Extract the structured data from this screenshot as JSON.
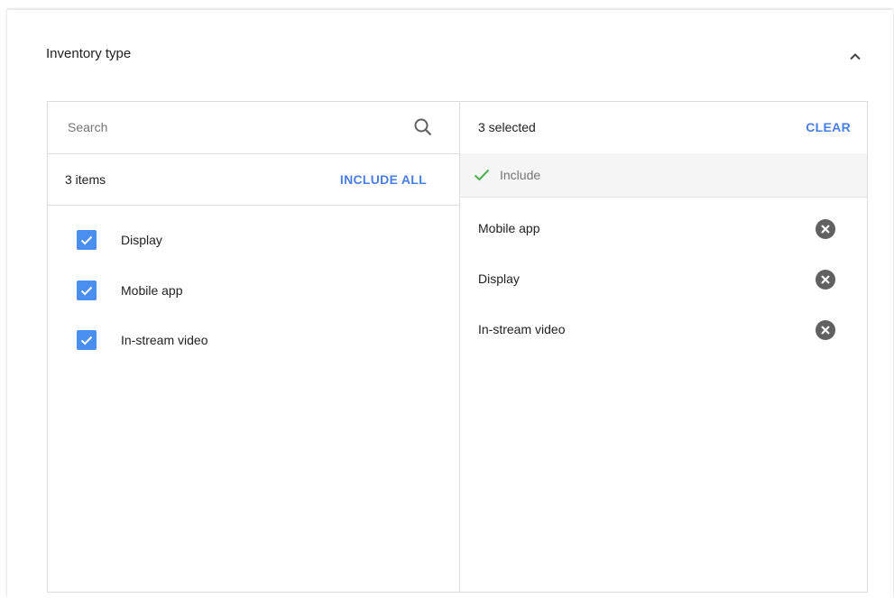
{
  "section": {
    "title": "Inventory type"
  },
  "search": {
    "placeholder": "Search",
    "value": ""
  },
  "available": {
    "count_label": "3 items",
    "include_all_label": "INCLUDE ALL",
    "options": [
      {
        "label": "Display",
        "checked": true
      },
      {
        "label": "Mobile app",
        "checked": true
      },
      {
        "label": "In-stream video",
        "checked": true
      }
    ]
  },
  "selected": {
    "count_label": "3 selected",
    "clear_label": "CLEAR",
    "group_label": "Include",
    "items": [
      {
        "label": "Mobile app"
      },
      {
        "label": "Display"
      },
      {
        "label": "In-stream video"
      }
    ]
  },
  "icons": {
    "collapse": "chevron-up-icon",
    "search": "search-icon",
    "check": "check-icon",
    "remove": "remove-circle-icon"
  },
  "colors": {
    "accent": "#4a7ee8",
    "checkbox": "#4a8ef0",
    "include_check": "#4caf50",
    "remove_icon": "#616161"
  }
}
